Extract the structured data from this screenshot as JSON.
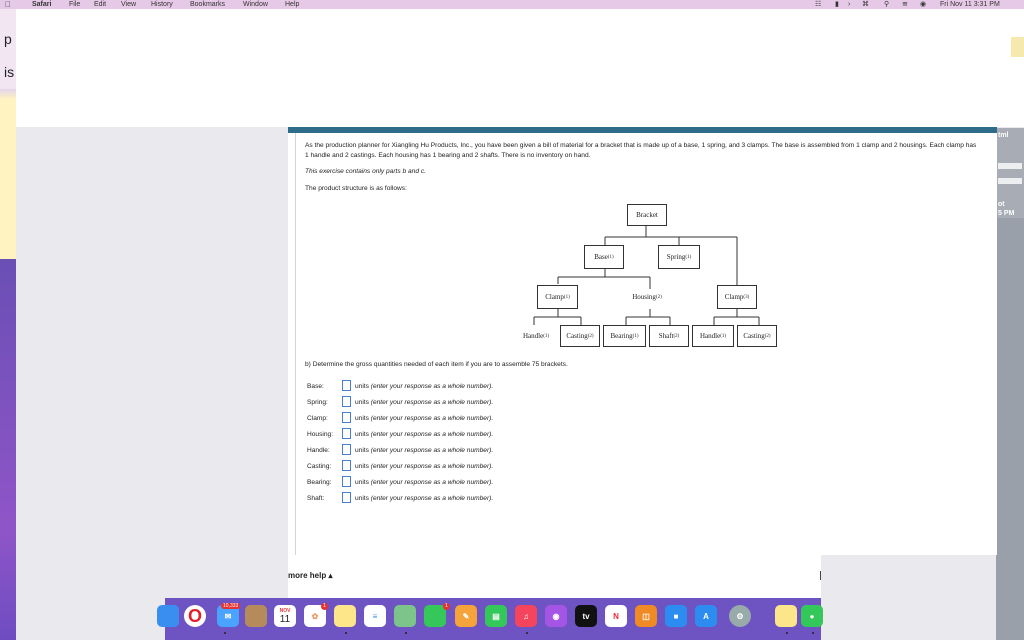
{
  "menubar": {
    "apple": "",
    "app": "Safari",
    "items": [
      "File",
      "Edit",
      "View",
      "History",
      "Bookmarks",
      "Window",
      "Help"
    ],
    "clock": "Fri Nov 11  3:31 PM"
  },
  "background_peek": {
    "left_top": "p",
    "left_mid": "is",
    "right_a": "tml",
    "right_b": "ot",
    "right_c": "5 PM"
  },
  "problem": {
    "intro": "As the production planner for Xiangling Hu Products, Inc., you have been given a bill of material for a bracket that is made up of a base, 1 spring, and 3 clamps. The base is assembled from 1 clamp and 2 housings. Each clamp has 1 handle and 2 castings. Each housing has 1 bearing and 2 shafts. There is no inventory on hand.",
    "note": "This exercise contains only parts b and c.",
    "structure_label": "The product structure is as follows:",
    "question": "b) Determine the gross quantities needed of each item if you are to assemble 75 brackets."
  },
  "diagram": {
    "bracket": "Bracket",
    "base": "Base",
    "base_q": "(1)",
    "spring": "Spring",
    "spring_q": "(1)",
    "clamp1": "Clamp",
    "clamp1_q": "(1)",
    "housing": "Housing",
    "housing_q": "(2)",
    "clamp3": "Clamp",
    "clamp3_q": "(3)",
    "handle1": "Handle",
    "handle1_q": "(1)",
    "casting1": "Casting",
    "casting1_q": "(2)",
    "bearing": "Bearing",
    "bearing_q": "(1)",
    "shaft": "Shaft",
    "shaft_q": "(2)",
    "handle2": "Handle",
    "handle2_q": "(1)",
    "casting2": "Casting",
    "casting2_q": "(2)"
  },
  "answers": [
    {
      "label": "Base:",
      "value": ""
    },
    {
      "label": "Spring:",
      "value": ""
    },
    {
      "label": "Clamp:",
      "value": ""
    },
    {
      "label": "Housing:",
      "value": ""
    },
    {
      "label": "Handle:",
      "value": ""
    },
    {
      "label": "Casting:",
      "value": ""
    },
    {
      "label": "Bearing:",
      "value": ""
    },
    {
      "label": "Shaft:",
      "value": ""
    }
  ],
  "answer_units": "units",
  "answer_hint": "(enter your response as a whole number).",
  "footer": {
    "more_help": "more help ▴"
  },
  "dock": {
    "mail_badge": "10,333",
    "calendar_month": "NOV",
    "calendar_day": "11",
    "messages_badge": "1",
    "tv_label": "tv",
    "icons": [
      "finder-icon",
      "opera-icon",
      "mail-icon",
      "contacts-icon",
      "calendar-icon",
      "photos-icon",
      "notes-icon",
      "reminders-icon",
      "maps-icon",
      "facetime-icon",
      "pages-icon",
      "numbers-icon",
      "music-icon",
      "podcasts-icon",
      "appletv-icon",
      "news-icon",
      "books-icon",
      "keynote-icon",
      "appstore-icon",
      "settings-icon",
      "stickies-icon",
      "messages-icon"
    ]
  }
}
